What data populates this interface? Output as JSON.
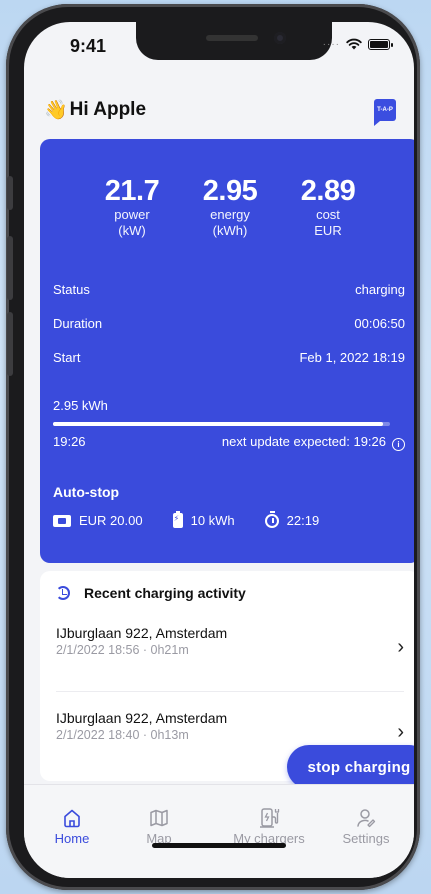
{
  "status_bar": {
    "time": "9:41"
  },
  "header": {
    "greeting_emoji": "👋",
    "greeting": "Hi Apple",
    "logo_text": "T-A-P"
  },
  "session": {
    "metrics": [
      {
        "value": "21.7",
        "label": "power",
        "unit": "(kW)"
      },
      {
        "value": "2.95",
        "label": "energy",
        "unit": "(kWh)"
      },
      {
        "value": "2.89",
        "label": "cost",
        "unit": "EUR"
      }
    ],
    "details": [
      {
        "label": "Status",
        "value": "charging"
      },
      {
        "label": "Duration",
        "value": "00:06:50"
      },
      {
        "label": "Start",
        "value": "Feb 1, 2022 18:19"
      }
    ],
    "progress_label": "2.95 kWh",
    "progress_fraction": 0.98,
    "progress_time": "19:26",
    "next_update": "next update expected: 19:26",
    "info_glyph": "i",
    "autostop": {
      "title": "Auto-stop",
      "items": [
        {
          "icon": "wallet-icon",
          "value": "EUR 20.00"
        },
        {
          "icon": "battery-charge-icon",
          "value": "10 kWh"
        },
        {
          "icon": "timer-icon",
          "value": "22:19"
        }
      ]
    }
  },
  "recent": {
    "title": "Recent charging activity",
    "items": [
      {
        "address": "IJburglaan 922, Amsterdam",
        "meta": "2/1/2022 18:56 · 0h21m"
      },
      {
        "address": "IJburglaan 922, Amsterdam",
        "meta": "2/1/2022 18:40 · 0h13m"
      }
    ]
  },
  "stop_button": {
    "label": "stop charging"
  },
  "tabs": [
    {
      "label": "Home",
      "icon": "home-icon",
      "active": true
    },
    {
      "label": "Map",
      "icon": "map-icon",
      "active": false
    },
    {
      "label": "My chargers",
      "icon": "charger-icon",
      "active": false
    },
    {
      "label": "Settings",
      "icon": "user-settings-icon",
      "active": false
    }
  ],
  "colors": {
    "primary": "#3a4bdc",
    "background": "#f3f4f7",
    "muted": "#9a9aa3"
  }
}
